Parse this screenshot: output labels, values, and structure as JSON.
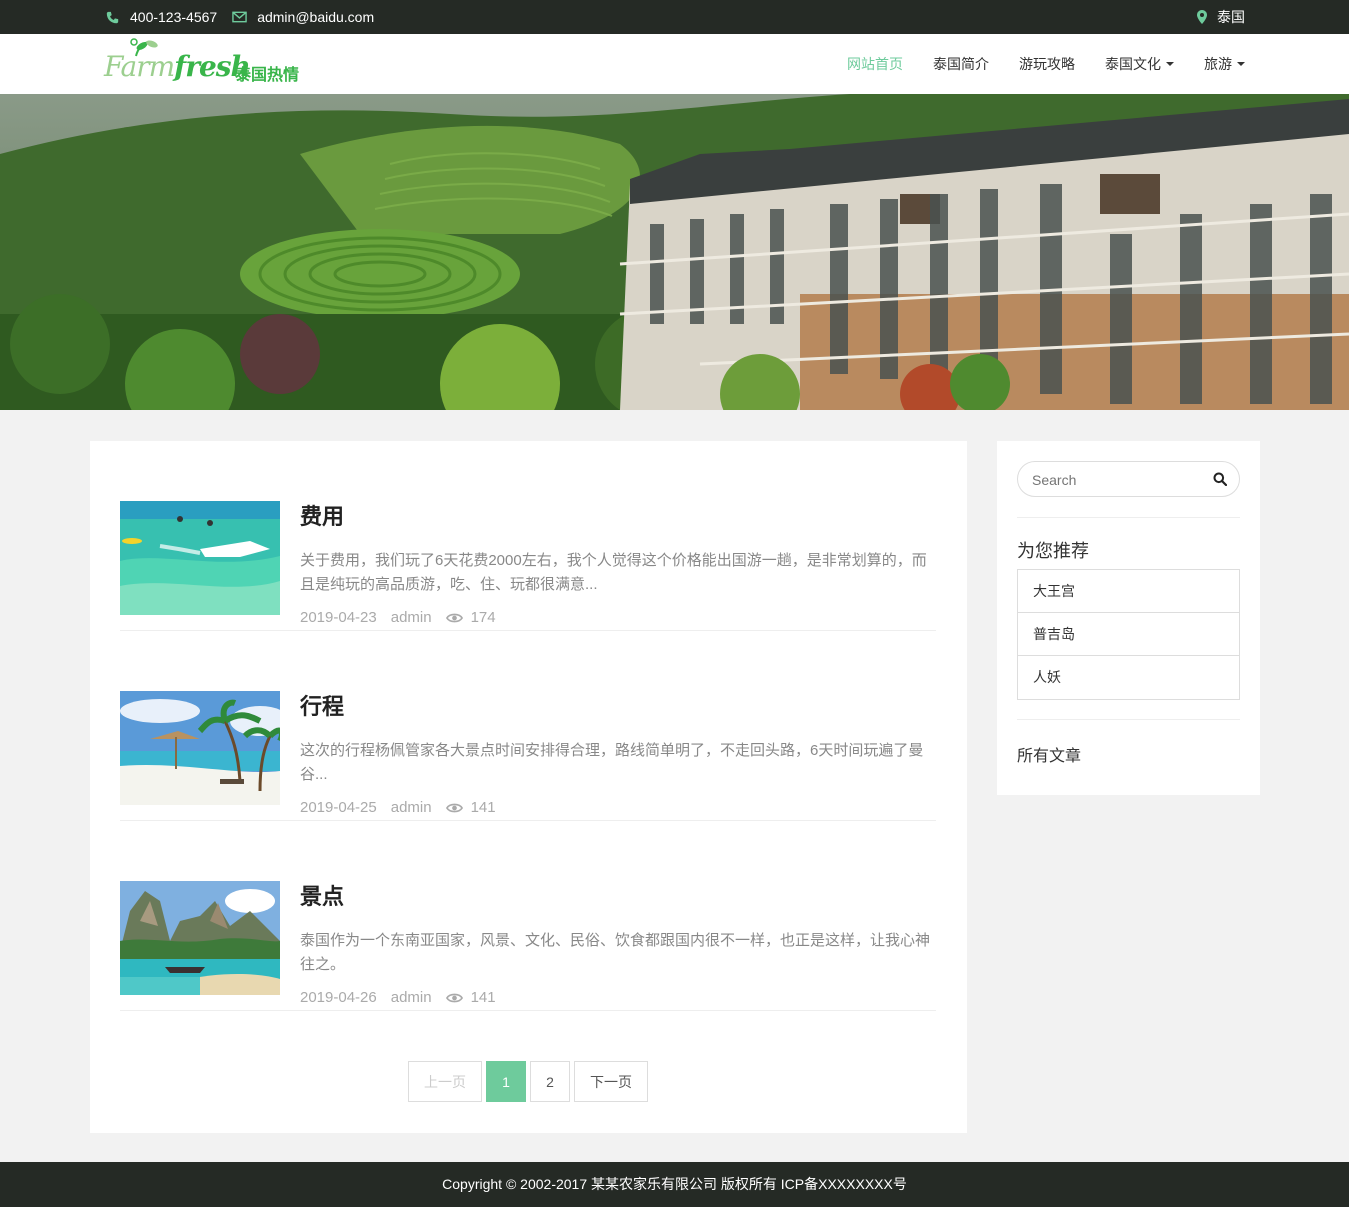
{
  "topbar": {
    "phone": "400-123-4567",
    "email": "admin@baidu.com",
    "location": "泰国",
    "icons": [
      "phone-icon",
      "envelope-icon",
      "map-marker-icon"
    ],
    "icon_color": "#6ecb9c"
  },
  "header": {
    "logo_farm": "Farm",
    "logo_fresh": "fresh",
    "logo_cn": "泰国热情",
    "nav": [
      {
        "label": "网站首页",
        "active": true,
        "dropdown": false
      },
      {
        "label": "泰国简介",
        "active": false,
        "dropdown": false
      },
      {
        "label": "游玩攻略",
        "active": false,
        "dropdown": false
      },
      {
        "label": "泰国文化",
        "active": false,
        "dropdown": true
      },
      {
        "label": "旅游",
        "active": false,
        "dropdown": true
      }
    ]
  },
  "posts": [
    {
      "title": "费用",
      "excerpt": "关于费用，我们玩了6天花费2000左右，我个人觉得这个价格能出国游一趟，是非常划算的，而且是纯玩的高品质游，吃、住、玩都很满意...",
      "date": "2019-04-23",
      "author": "admin",
      "views": "174"
    },
    {
      "title": "行程",
      "excerpt": "这次的行程杨佩管家各大景点时间安排得合理，路线简单明了，不走回头路，6天时间玩遍了曼谷...",
      "date": "2019-04-25",
      "author": "admin",
      "views": "141"
    },
    {
      "title": "景点",
      "excerpt": "泰国作为一个东南亚国家，风景、文化、民俗、饮食都跟国内很不一样，也正是这样，让我心神往之。",
      "date": "2019-04-26",
      "author": "admin",
      "views": "141"
    }
  ],
  "pagination": {
    "prev": "上一页",
    "pages": [
      "1",
      "2"
    ],
    "current": "1",
    "next": "下一页"
  },
  "sidebar": {
    "search_placeholder": "Search",
    "recommend_title": "为您推荐",
    "recommend": [
      "大王宫",
      "普吉岛",
      "人妖"
    ],
    "all_articles": "所有文章"
  },
  "footer": {
    "copyright": "Copyright © 2002-2017 某某农家乐有限公司 版权所有 ICP备XXXXXXXX号"
  },
  "colors": {
    "accent": "#6ecb9c",
    "dark": "#252a25",
    "logo_green": "#39b54a"
  }
}
